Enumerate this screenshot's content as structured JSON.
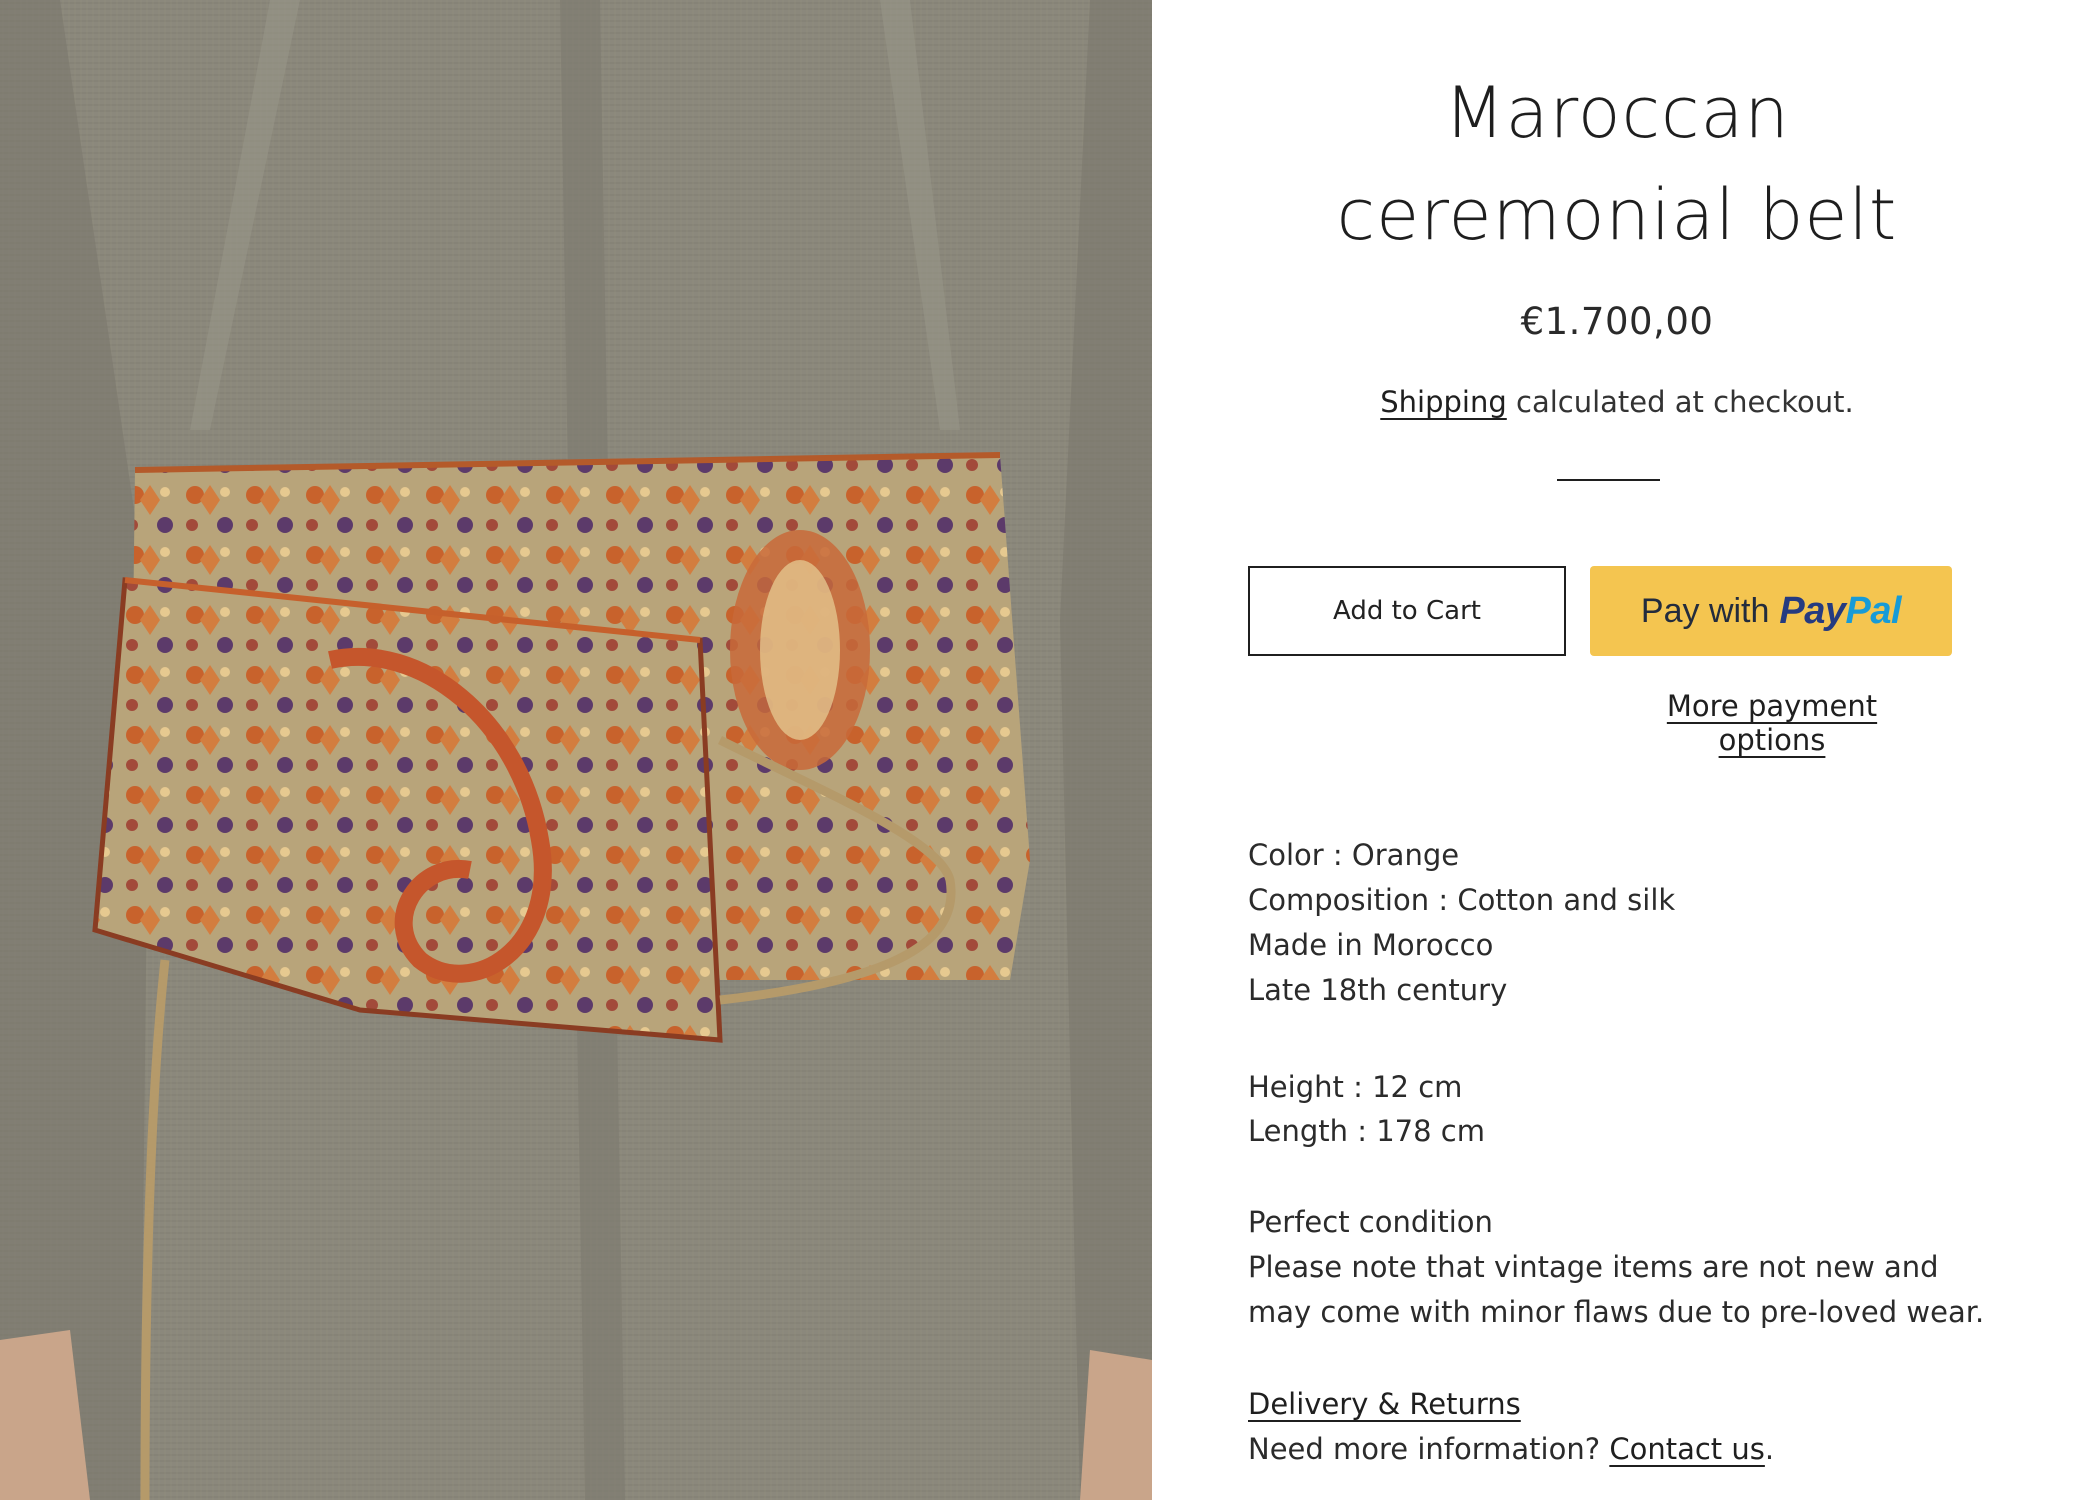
{
  "product": {
    "title_line1": "Maroccan",
    "title_line2": "ceremonial belt",
    "price": "€1.700,00",
    "shipping_link": "Shipping",
    "shipping_note": " calculated at checkout.",
    "image_alt": "Model wearing a woven orange Moroccan ceremonial belt over a grey linen coat"
  },
  "actions": {
    "add_to_cart": "Add to Cart",
    "paypal_prefix": "Pay with",
    "paypal_brand_pay": "Pay",
    "paypal_brand_pal": "Pal",
    "more_payment_options": "More payment options"
  },
  "details": {
    "color": "Color : Orange",
    "composition": "Composition : Cotton and silk",
    "origin": "Made in Morocco",
    "era": "Late 18th century",
    "height": "Height : 12 cm",
    "length": "Length : 178 cm",
    "condition": "Perfect condition",
    "condition_note": "Please note that vintage items are not new and may come with minor flaws due to pre-loved wear."
  },
  "footer_links": {
    "delivery_returns": "Delivery & Returns",
    "info_prefix": "Need more information? ",
    "contact": "Contact us",
    "info_suffix": "."
  },
  "colors": {
    "paypal_yellow": "#f4c550",
    "paypal_dark_blue": "#253b80",
    "paypal_light_blue": "#179bd7",
    "coat_grey": "#8b887c",
    "belt_orange": "#c96a34"
  }
}
